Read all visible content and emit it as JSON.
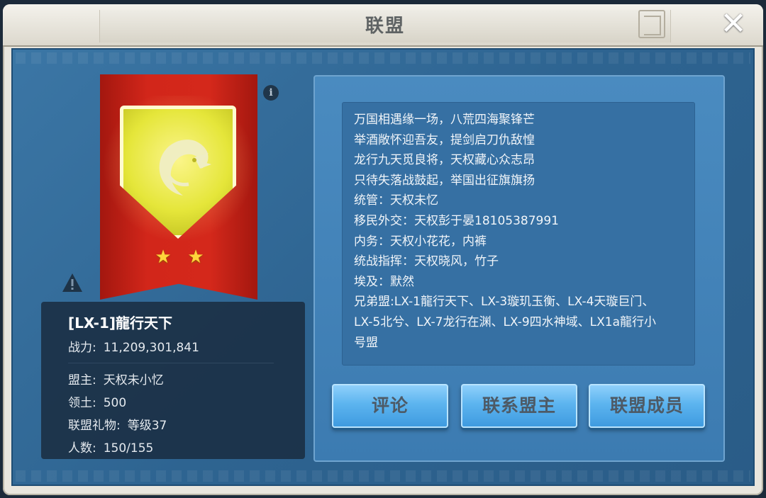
{
  "window": {
    "title": "联盟",
    "close_glyph": "✕"
  },
  "alliance": {
    "name": "[LX-1]龍行天下",
    "power_label": "战力:",
    "power_value": "11,209,301,841",
    "leader_label": "盟主:",
    "leader_value": "天权未小忆",
    "territory_label": "领土:",
    "territory_value": "500",
    "gift_label": "联盟礼物:",
    "gift_value": "等级37",
    "members_label": "人数:",
    "members_value": "150/155",
    "stars": 2
  },
  "colors": {
    "banner": "#d2261a",
    "shield": "#e5e63a",
    "panel": "#2e6491",
    "button": "#5cb4ef"
  },
  "icons": {
    "emblem": "dragon-icon",
    "info": "info-icon",
    "warning": "warning-icon",
    "star": "star-icon"
  },
  "manifesto": [
    "万国相遇缘一场，八荒四海聚锋芒",
    "举酒敞怀迎吾友，提剑启刀仇敌惶",
    "龙行九天觅良将，天权藏心众志昂",
    "只待失落战鼓起，举国出征旗旗扬",
    "统管：天权未忆",
    "移民外交：天权彭于晏18105387991",
    "内务：天权小花花，内裤",
    "统战指挥：天权晓风，竹子",
    "埃及：默然",
    "兄弟盟:LX-1龍行天下、LX-3璇玑玉衡、LX-4天璇巨门、",
    "LX-5北兮、LX-7龙行在渊、LX-9四水神域、LX1a龍行小",
    "号盟"
  ],
  "buttons": {
    "comment": "评论",
    "contact_leader": "联系盟主",
    "members": "联盟成员"
  }
}
